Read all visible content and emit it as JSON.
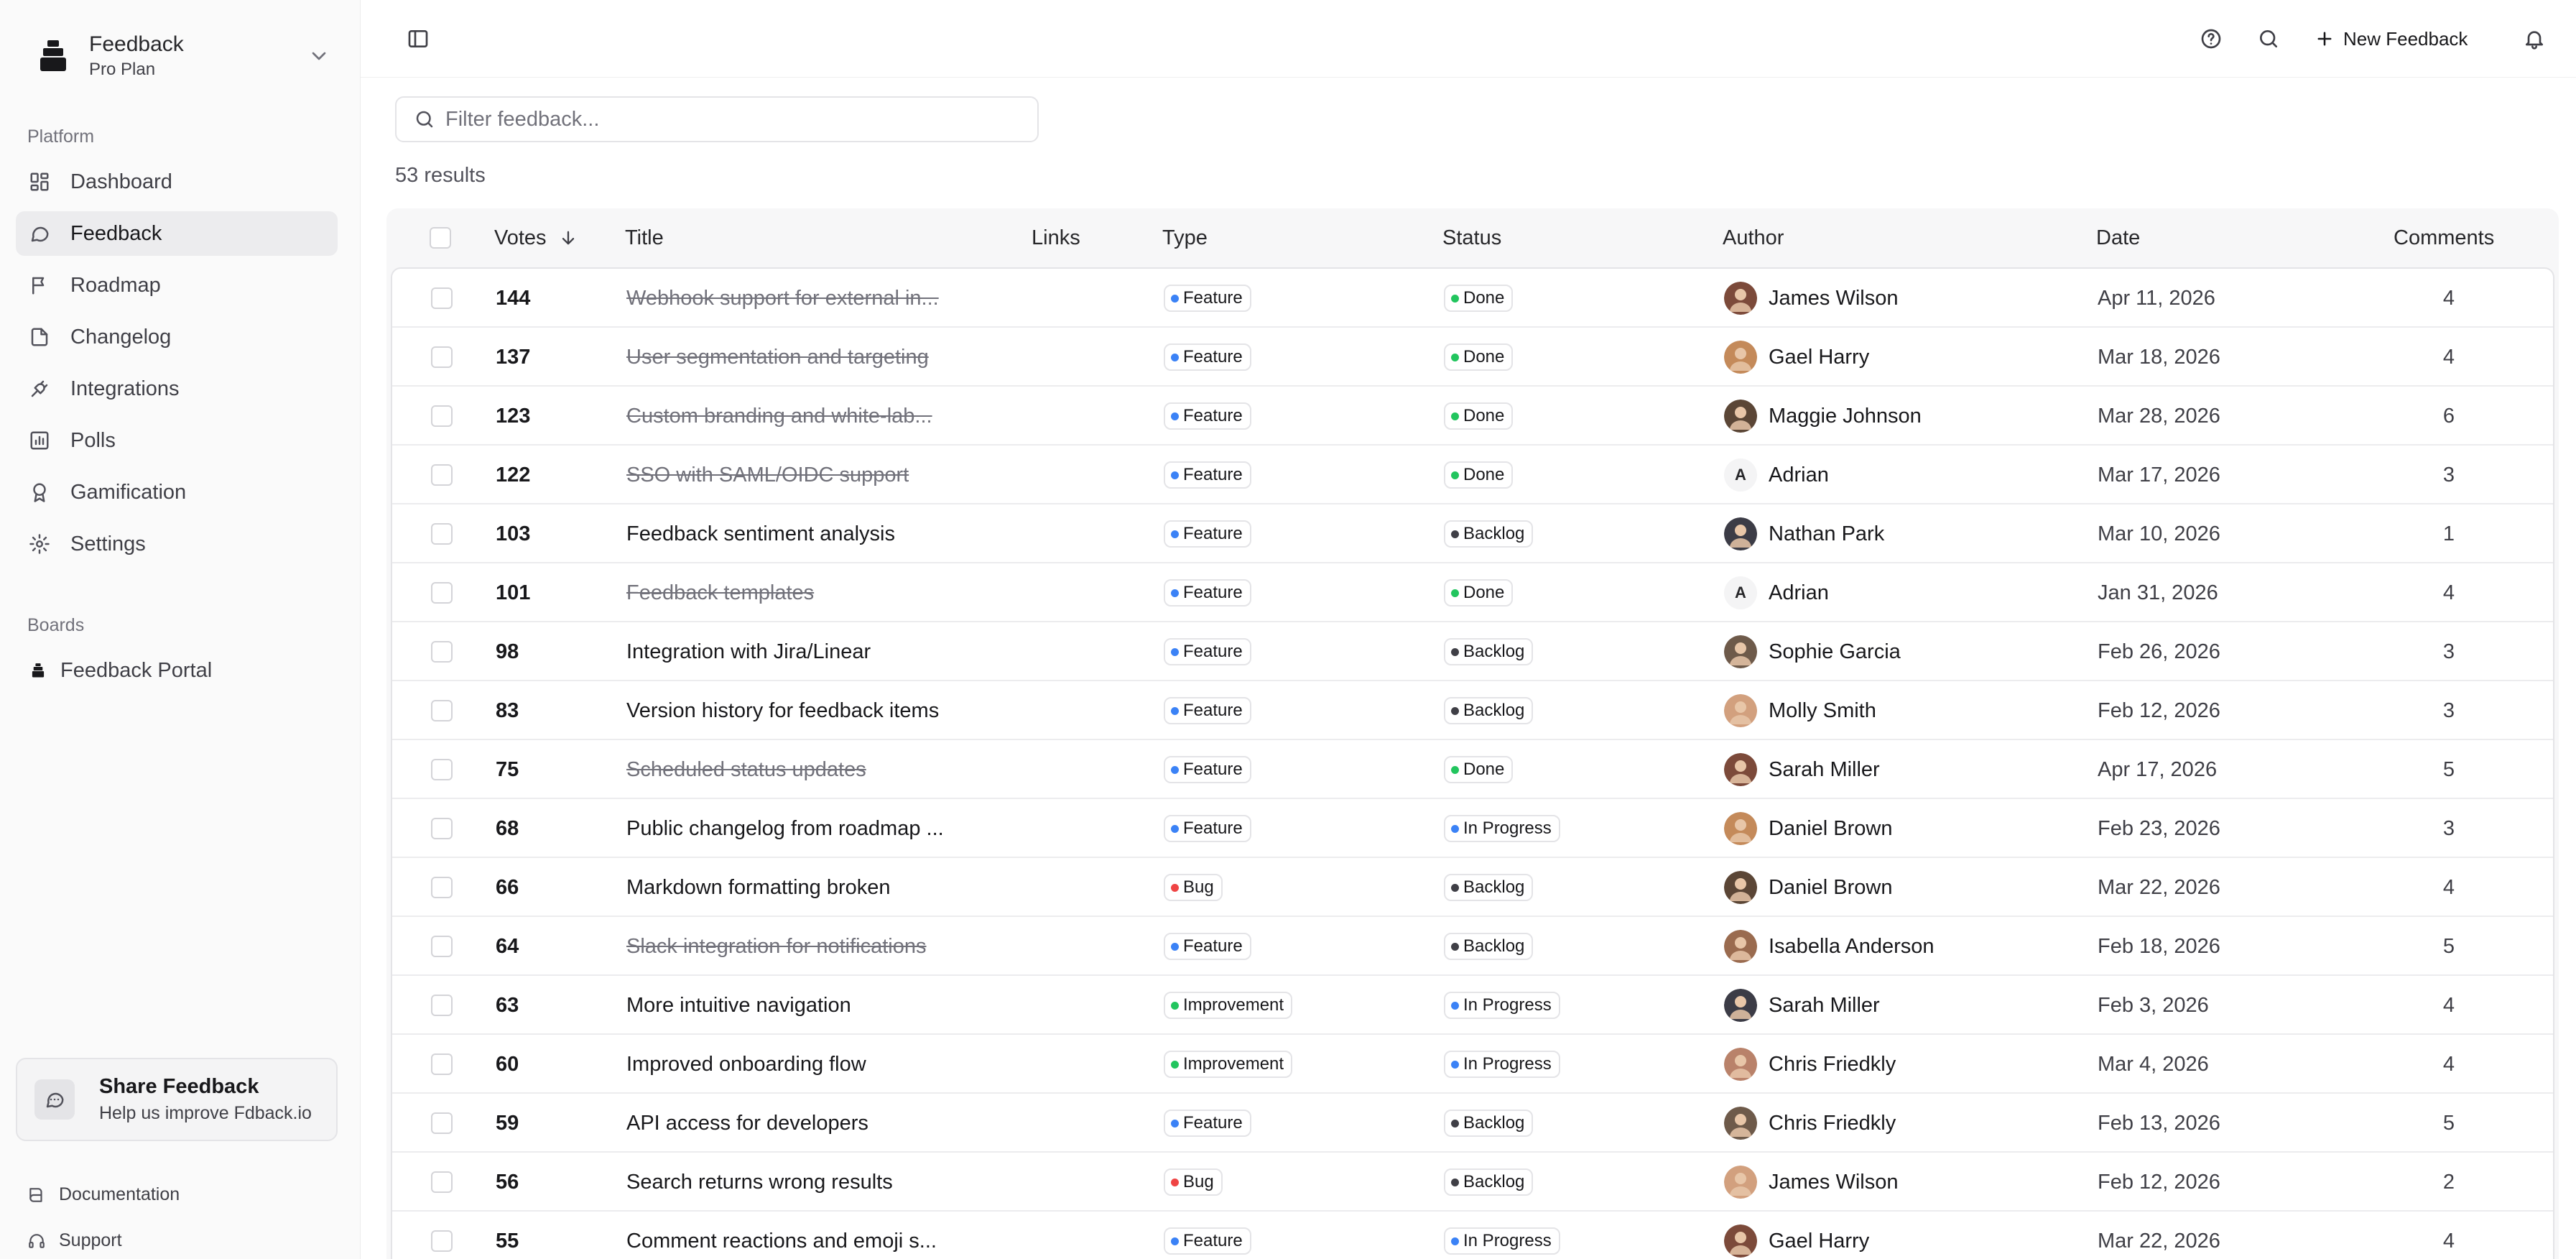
{
  "workspace": {
    "name": "Feedback",
    "plan": "Pro Plan"
  },
  "sidebar": {
    "platform_label": "Platform",
    "items": [
      {
        "label": "Dashboard",
        "icon": "dashboard-icon"
      },
      {
        "label": "Feedback",
        "icon": "message-icon",
        "active": true
      },
      {
        "label": "Roadmap",
        "icon": "roadmap-icon"
      },
      {
        "label": "Changelog",
        "icon": "file-icon"
      },
      {
        "label": "Integrations",
        "icon": "plug-icon"
      },
      {
        "label": "Polls",
        "icon": "poll-icon"
      },
      {
        "label": "Gamification",
        "icon": "award-icon"
      },
      {
        "label": "Settings",
        "icon": "gear-icon"
      }
    ],
    "boards_label": "Boards",
    "boards": [
      {
        "label": "Feedback Portal",
        "icon": "logo-icon"
      }
    ],
    "share": {
      "title": "Share Feedback",
      "subtitle": "Help us improve Fdback.io"
    },
    "footer": [
      {
        "label": "Documentation",
        "icon": "book-icon"
      },
      {
        "label": "Support",
        "icon": "headset-icon"
      }
    ]
  },
  "topbar": {
    "new_label": "New Feedback"
  },
  "filter": {
    "placeholder": "Filter feedback...",
    "value": ""
  },
  "results_label": "53 results",
  "colors": {
    "feature": "#3b82f6",
    "bug": "#ef4444",
    "improvement": "#22c55e",
    "done": "#22c55e",
    "backlog": "#3f3f46",
    "in_progress": "#3b82f6"
  },
  "table": {
    "columns": {
      "votes": "Votes",
      "title": "Title",
      "links": "Links",
      "type": "Type",
      "status": "Status",
      "author": "Author",
      "date": "Date",
      "comments": "Comments"
    },
    "sort": {
      "column": "votes",
      "direction": "desc"
    },
    "rows": [
      {
        "votes": "144",
        "title": "Webhook support for external in...",
        "done": true,
        "type": "Feature",
        "status": "Done",
        "author": "James Wilson",
        "date": "Apr 11, 2026",
        "comments": "4"
      },
      {
        "votes": "137",
        "title": "User segmentation and targeting",
        "done": true,
        "type": "Feature",
        "status": "Done",
        "author": "Gael Harry",
        "date": "Mar 18, 2026",
        "comments": "4"
      },
      {
        "votes": "123",
        "title": "Custom branding and white-lab...",
        "done": true,
        "type": "Feature",
        "status": "Done",
        "author": "Maggie Johnson",
        "date": "Mar 28, 2026",
        "comments": "6"
      },
      {
        "votes": "122",
        "title": "SSO with SAML/OIDC support",
        "done": true,
        "type": "Feature",
        "status": "Done",
        "author": "Adrian",
        "initial": "A",
        "date": "Mar 17, 2026",
        "comments": "3"
      },
      {
        "votes": "103",
        "title": "Feedback sentiment analysis",
        "done": false,
        "type": "Feature",
        "status": "Backlog",
        "author": "Nathan Park",
        "date": "Mar 10, 2026",
        "comments": "1"
      },
      {
        "votes": "101",
        "title": "Feedback templates",
        "done": true,
        "type": "Feature",
        "status": "Done",
        "author": "Adrian",
        "initial": "A",
        "date": "Jan 31, 2026",
        "comments": "4"
      },
      {
        "votes": "98",
        "title": "Integration with Jira/Linear",
        "done": false,
        "type": "Feature",
        "status": "Backlog",
        "author": "Sophie Garcia",
        "date": "Feb 26, 2026",
        "comments": "3"
      },
      {
        "votes": "83",
        "title": "Version history for feedback items",
        "done": false,
        "type": "Feature",
        "status": "Backlog",
        "author": "Molly Smith",
        "date": "Feb 12, 2026",
        "comments": "3"
      },
      {
        "votes": "75",
        "title": "Scheduled status updates",
        "done": true,
        "type": "Feature",
        "status": "Done",
        "author": "Sarah Miller",
        "date": "Apr 17, 2026",
        "comments": "5"
      },
      {
        "votes": "68",
        "title": "Public changelog from roadmap ...",
        "done": false,
        "type": "Feature",
        "status": "In Progress",
        "author": "Daniel Brown",
        "date": "Feb 23, 2026",
        "comments": "3"
      },
      {
        "votes": "66",
        "title": "Markdown formatting broken",
        "done": false,
        "type": "Bug",
        "status": "Backlog",
        "author": "Daniel Brown",
        "date": "Mar 22, 2026",
        "comments": "4"
      },
      {
        "votes": "64",
        "title": "Slack integration for notifications",
        "done": true,
        "type": "Feature",
        "status": "Backlog",
        "author": "Isabella Anderson",
        "date": "Feb 18, 2026",
        "comments": "5"
      },
      {
        "votes": "63",
        "title": "More intuitive navigation",
        "done": false,
        "type": "Improvement",
        "status": "In Progress",
        "author": "Sarah Miller",
        "date": "Feb 3, 2026",
        "comments": "4"
      },
      {
        "votes": "60",
        "title": "Improved onboarding flow",
        "done": false,
        "type": "Improvement",
        "status": "In Progress",
        "author": "Chris Friedkly",
        "date": "Mar 4, 2026",
        "comments": "4"
      },
      {
        "votes": "59",
        "title": "API access for developers",
        "done": false,
        "type": "Feature",
        "status": "Backlog",
        "author": "Chris Friedkly",
        "date": "Feb 13, 2026",
        "comments": "5"
      },
      {
        "votes": "56",
        "title": "Search returns wrong results",
        "done": false,
        "type": "Bug",
        "status": "Backlog",
        "author": "James Wilson",
        "date": "Feb 12, 2026",
        "comments": "2"
      },
      {
        "votes": "55",
        "title": "Comment reactions and emoji s...",
        "done": false,
        "type": "Feature",
        "status": "In Progress",
        "author": "Gael Harry",
        "date": "Mar 22, 2026",
        "comments": "4"
      }
    ]
  }
}
